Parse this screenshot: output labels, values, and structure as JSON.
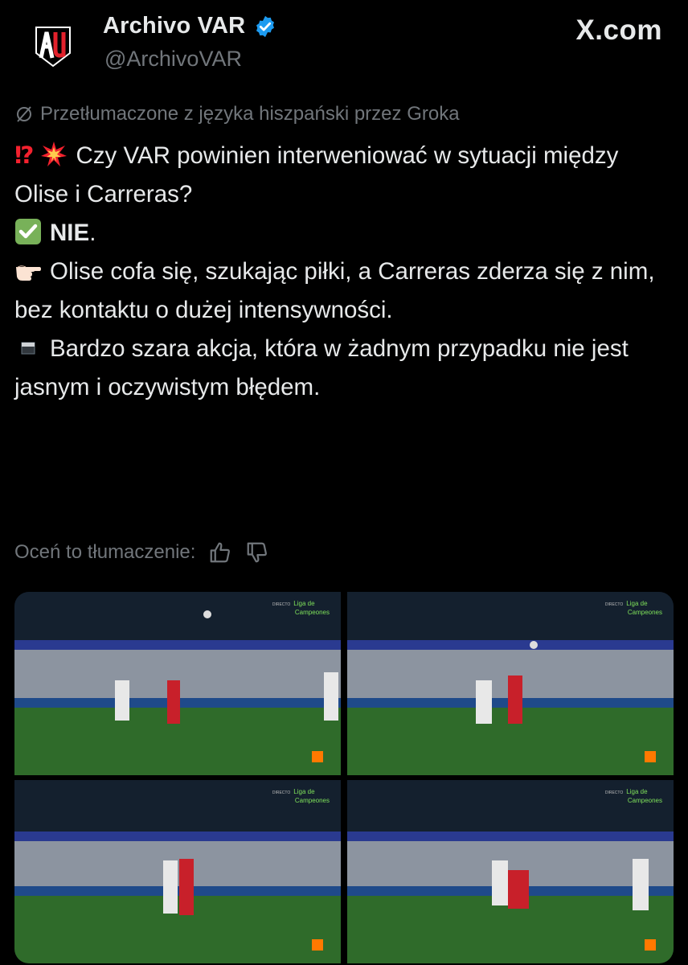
{
  "author": {
    "display_name": "Archivo VAR",
    "handle": "@ArchivoVAR",
    "verified": true,
    "avatar_icon": "archivo-var-logo"
  },
  "source": {
    "label": "X.com"
  },
  "translation_note": "Przetłumaczone z języka hiszpański przez Groka",
  "post": {
    "line1_emojis": [
      "⁉️",
      "💥"
    ],
    "line1_text": "Czy VAR powinien interweniować w sytuacji między Olise i Carreras?",
    "verdict_emoji": "✅",
    "verdict_text": "NIE",
    "verdict_suffix": ".",
    "point_emoji": "👉🏻",
    "point_text": "Olise cofa się, szukając piłki, a Carreras zderza się z nim, bez kontaktu o dużej intensywności.",
    "grey_emoji": "▪️",
    "grey_text": "Bardzo szara akcja, która w żadnym przypadku nie jest jasnym i oczywistym błędem."
  },
  "rate_translation": {
    "label": "Oceń to tłumaczenie:",
    "thumbs_up_icon": "thumbs-up-icon",
    "thumbs_down_icon": "thumbs-down-icon"
  },
  "media": {
    "broadcast_label_small": "DIRECTO",
    "broadcast_label_line1": "Liga de",
    "broadcast_label_line2": "Campeones",
    "images": [
      {
        "alt": "match-frame-1"
      },
      {
        "alt": "match-frame-2"
      },
      {
        "alt": "match-frame-3"
      },
      {
        "alt": "match-frame-4"
      }
    ]
  },
  "colors": {
    "background": "#000000",
    "text": "#e7e9ea",
    "muted": "#71767b",
    "verified": "#1d9bf0",
    "pitch": "#2f6b2a"
  }
}
